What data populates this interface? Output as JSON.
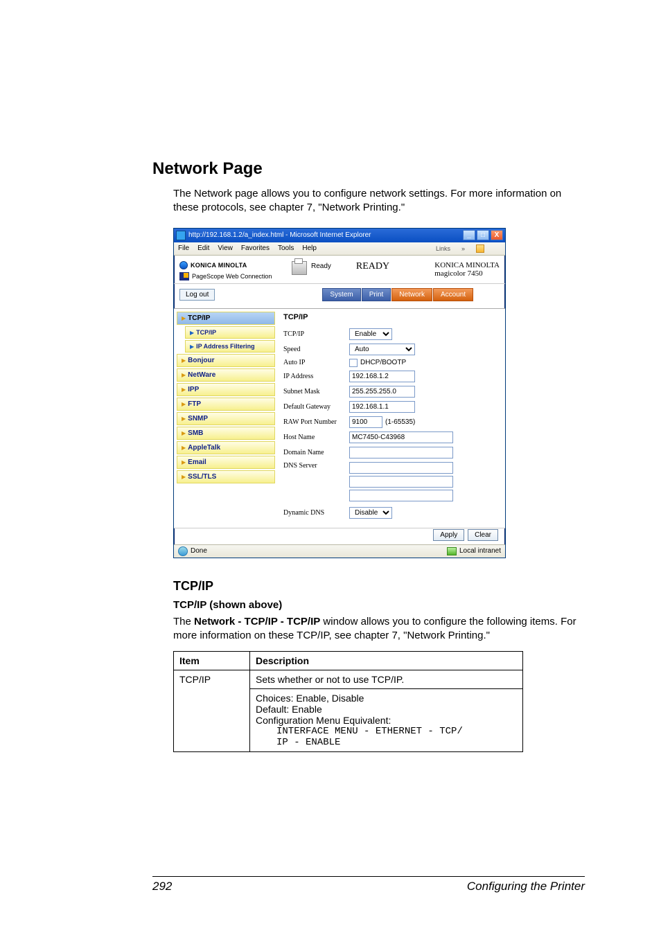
{
  "doc": {
    "h1": "Network Page",
    "intro": "The Network page allows you to configure network settings. For more information on these protocols, see chapter 7, \"Network Printing.\"",
    "h2": "TCP/IP",
    "h3": "TCP/IP (shown above)",
    "para_pre": "The ",
    "para_bold": "Network - TCP/IP - TCP/IP",
    "para_post": " window allows you to configure the following items. For more information on these TCP/IP, see chapter 7, \"Network Printing.\"",
    "table": {
      "head_item": "Item",
      "head_desc": "Description",
      "row_item": "TCP/IP",
      "row_desc_line1": "Sets whether or not to use TCP/IP.",
      "row_desc_line2": "Choices: Enable, Disable",
      "row_desc_line3": "Default:  Enable",
      "row_desc_line4": "Configuration Menu Equivalent:",
      "row_desc_code1": "INTERFACE MENU - ETHERNET - TCP/",
      "row_desc_code2": "IP - ENABLE"
    },
    "footer_page": "292",
    "footer_chapter": "Configuring the Printer"
  },
  "win": {
    "title": "http://192.168.1.2/a_index.html - Microsoft Internet Explorer",
    "btn_min": "_",
    "btn_max": "□",
    "btn_close": "X",
    "menu": {
      "file": "File",
      "edit": "Edit",
      "view": "View",
      "fav": "Favorites",
      "tools": "Tools",
      "help": "Help",
      "links": "Links"
    },
    "banner": {
      "logo": "KONICA MINOLTA",
      "pagescope": "PageScope Web Connection",
      "ready_small": "Ready",
      "ready_big": "READY",
      "right1": "KONICA MINOLTA",
      "right2": "magicolor 7450"
    },
    "logout": "Log out",
    "tabs": {
      "system": "System",
      "print": "Print",
      "network": "Network",
      "account": "Account"
    },
    "nav": {
      "tcpip": "TCP/IP",
      "tcpip_sub": "TCP/IP",
      "ipaf": "IP Address Filtering",
      "bonjour": "Bonjour",
      "netware": "NetWare",
      "ipp": "IPP",
      "ftp": "FTP",
      "snmp": "SNMP",
      "smb": "SMB",
      "appletalk": "AppleTalk",
      "email": "Email",
      "ssl": "SSL/TLS"
    },
    "form": {
      "heading": "TCP/IP",
      "tcpip_label": "TCP/IP",
      "tcpip_value": "Enable",
      "speed_label": "Speed",
      "speed_value": "Auto",
      "autoip_label": "Auto IP",
      "autoip_text": "DHCP/BOOTP",
      "ipaddr_label": "IP Address",
      "ipaddr_value": "192.168.1.2",
      "subnet_label": "Subnet Mask",
      "subnet_value": "255.255.255.0",
      "gw_label": "Default Gateway",
      "gw_value": "192.168.1.1",
      "raw_label": "RAW Port Number",
      "raw_value": "9100",
      "raw_range": "(1-65535)",
      "host_label": "Host Name",
      "host_value": "MC7450-C43968",
      "domain_label": "Domain Name",
      "dns_label": "DNS Server",
      "ddns_label": "Dynamic DNS",
      "ddns_value": "Disable",
      "apply": "Apply",
      "clear": "Clear"
    },
    "status": {
      "done": "Done",
      "zone": "Local intranet"
    }
  }
}
